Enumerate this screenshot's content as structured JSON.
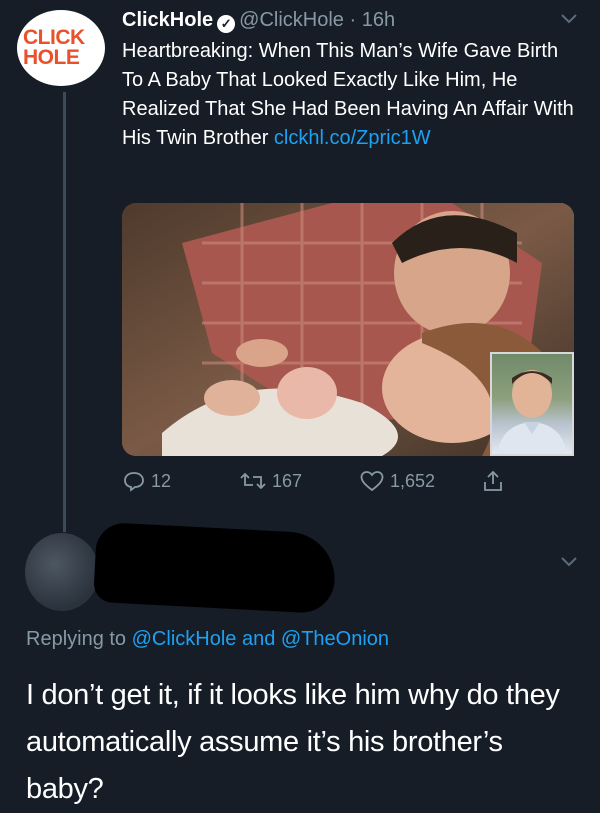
{
  "tweet": {
    "author_logo_line1": "CLICK",
    "author_logo_line2": "HOLE",
    "display_name": "ClickHole",
    "handle": "@ClickHole",
    "separator": "·",
    "time": "16h",
    "text": "Heartbreaking: When This Man’s Wife Gave Birth To A Baby That Looked Exactly Like Him, He Realized That She Had Been Having An Affair With His Twin Brother",
    "link": "clckhl.co/Zpric1W",
    "replies": "12",
    "retweets": "167",
    "likes": "1,652"
  },
  "reply": {
    "replying_prefix": "Replying to",
    "mention1": "@ClickHole",
    "conjunction": "and",
    "mention2": "@TheOnion",
    "text": "I don’t get it, if it looks like him why do they automatically assume it’s his brother’s baby?"
  },
  "colors": {
    "background": "#161d27",
    "link": "#1da1f2",
    "muted": "#8899a6",
    "brand": "#e8512a"
  }
}
